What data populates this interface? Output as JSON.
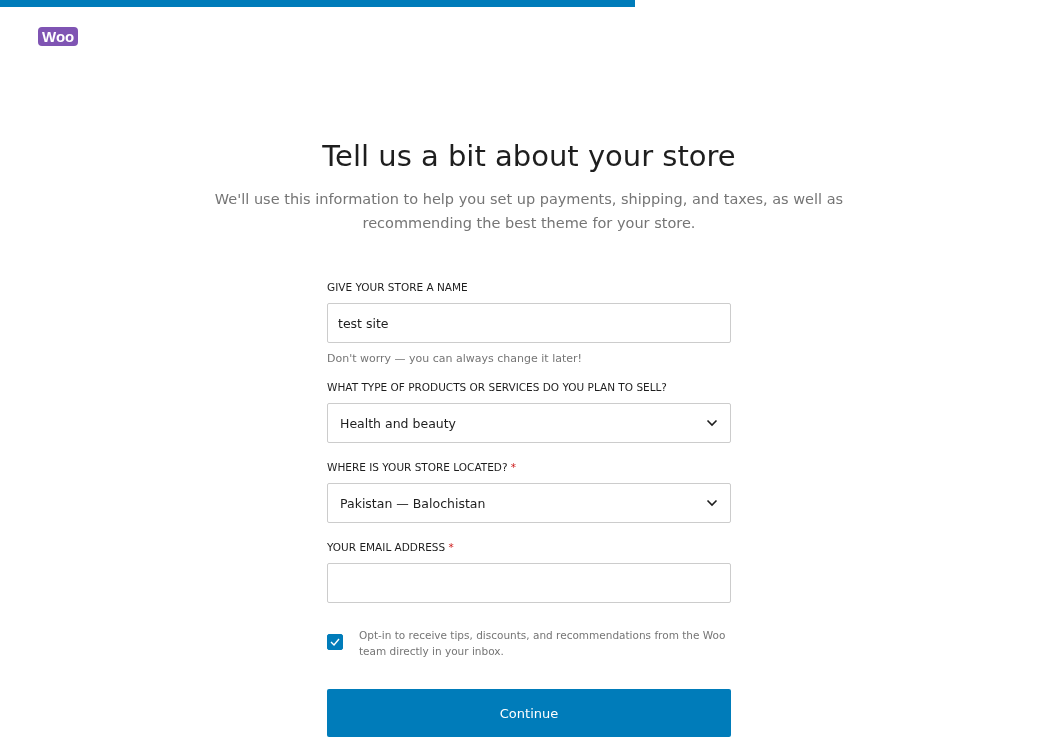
{
  "progress": {
    "level": 0.6
  },
  "logo": {
    "text": "Woo"
  },
  "title": "Tell us a bit about your store",
  "subtitle": "We'll use this information to help you set up payments, shipping, and taxes, as well as recommending the best theme for your store.",
  "fields": [
    {
      "kind": "text",
      "label": "GIVE YOUR STORE A NAME",
      "value": "test site",
      "help": "Don't worry — you can always change it later!"
    },
    {
      "kind": "select",
      "label": "WHAT TYPE OF PRODUCTS OR SERVICES DO YOU PLAN TO SELL?",
      "value": "Health and beauty"
    },
    {
      "kind": "select",
      "label": "WHERE IS YOUR STORE LOCATED?",
      "required_mark": "*",
      "value": "Pakistan — Balochistan"
    },
    {
      "kind": "text",
      "label": "YOUR EMAIL ADDRESS",
      "required_mark": "*"
    }
  ],
  "opt_in": {
    "checked": true,
    "label": "Opt-in to receive tips, discounts, and recommendations from the Woo team directly in your inbox."
  },
  "button": "Continue"
}
